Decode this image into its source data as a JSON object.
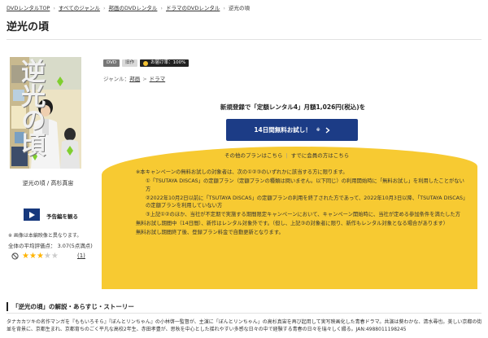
{
  "breadcrumb": {
    "items": [
      "DVDレンタルTOP",
      "すべてのジャンル",
      "邦画のDVDレンタル",
      "ドラマのDVDレンタル",
      "逆光の頃"
    ]
  },
  "work": {
    "title": "逆光の頃",
    "poster_title": "逆光の頃",
    "caption": "逆光の頃 / 高杉真宙",
    "trailer_label": "予告編を観る",
    "note": "※ 画像は本編映像と異なります。",
    "rating_text": "全体の平均評価点： 3.07(5点満点)",
    "stars_filled": 3,
    "stars_total": 5,
    "review_count": "(1)",
    "badges": {
      "format": "DVD",
      "old": "旧作",
      "delivery": "お届け率：100%"
    },
    "genre_label": "ジャンル：",
    "genre_main": "邦画",
    "genre_sub": "ドラマ"
  },
  "promo": {
    "headline": "新規登録で「定額レンタル4」月額1,026円(税込)を",
    "cta_label": "14日間無料お試し！",
    "cta_small": "※",
    "other_plans": "その他のプランはこちら",
    "member_plans": "すでに会員の方はこちら",
    "conditions": [
      "※本キャンペーンの無料お試しの対象者は、次の①②③のいずれかに該当する方に限ります。",
      "①「TSUTAYA DISCAS」の定額プラン（定額プランの種類は問いません。以下同じ）の利用開始時に「無料お試し」を利用したことがない方",
      "②2022年10月2日以前に「TSUTAYA DISCAS」の定額プランの利用を終了された方であって、2022年10月3日以降、「TSUTAYA DISCAS」の定額プランを利用していない方",
      "③上記①②のほか、当社が不定期で実施する期間限定キャンペーンにおいて、キャンペーン開始時に、当社が定める参加条件を満たした方",
      "無料お試し期間中（14日間）、新作はレンタル対象外です。（但し、上記③の対象者に限り、新作もレンタル対象となる場合があります）",
      "無料お試し期間終了後、登録プラン料金で自動更新となります。"
    ]
  },
  "section": {
    "heading": "「逆光の頃」の解説・あらすじ・ストーリー",
    "description": "タナカカツキの名作マンガを『ももいろそら』『ぼんとリンちゃん』の小林啓一監督が、主演に「ぼんとリンちゃん」の高杉真宙を再び起用して実写映画化した青春ドラマ。共演は葵わかな、清水尋也。美しい京都の街並を背景に、京都生まれ、京都育ちのごく平凡な高校2年生、赤田孝豊が、思秋を中心とした揺れやすい多感な日々の中で経験する青春の日々を瑞々しく綴る。JAN:4988011198245"
  },
  "colors": {
    "accent_blue": "#1c3c86",
    "promo_yellow": "#f7ca32",
    "star": "#ffb400"
  }
}
